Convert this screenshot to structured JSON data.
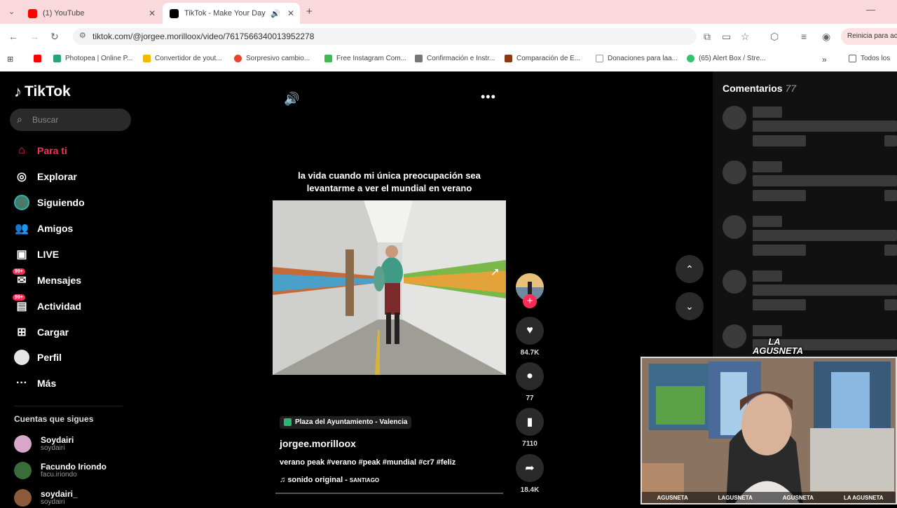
{
  "browser": {
    "tabs": [
      {
        "title": "(1) YouTube",
        "active": false
      },
      {
        "title": "TikTok - Make Your Day",
        "active": true
      }
    ],
    "url": "tiktok.com/@jorgee.morilloox/video/7617566340013952278",
    "restart_label": "Reinicia para act",
    "bookmarks": [
      "Photopea | Online P...",
      "Convertidor de yout...",
      "Sorpresivo cambio...",
      "Free Instagram Com...",
      "Confirmación e Instr...",
      "Comparación de E...",
      "Donaciones para laa...",
      "(65) Alert Box / Stre..."
    ],
    "all_bookmarks": "Todos los"
  },
  "sidebar": {
    "logo": "TikTok",
    "search_placeholder": "Buscar",
    "nav": [
      {
        "label": "Para ti"
      },
      {
        "label": "Explorar"
      },
      {
        "label": "Siguiendo"
      },
      {
        "label": "Amigos"
      },
      {
        "label": "LIVE"
      },
      {
        "label": "Mensajes",
        "badge": "99+"
      },
      {
        "label": "Actividad",
        "badge": "99+"
      },
      {
        "label": "Cargar"
      },
      {
        "label": "Perfil"
      },
      {
        "label": "Más"
      }
    ],
    "following_title": "Cuentas que sigues",
    "accounts": [
      {
        "name": "Soydairi",
        "user": "soydairi"
      },
      {
        "name": "Facundo Iriondo",
        "user": "facu.iriondo"
      },
      {
        "name": "soydairi_",
        "user": "soydairi"
      }
    ]
  },
  "video": {
    "caption": "la vida cuando mi única preocupación sea levantarme a ver el mundial en verano",
    "location": "Plaza del Ayuntamiento - Valencia",
    "author": "jorgee.morilloox",
    "description": "verano peak #verano #peak #mundial #cr7 #feliz",
    "sound": "sonido original - ",
    "sound_artist": "SANTIAGO",
    "likes": "84.7K",
    "comments": "77",
    "saves": "7110",
    "shares": "18.4K"
  },
  "comments_panel": {
    "title": "Comentarios",
    "count": "77"
  },
  "webcam": {
    "brand": "LA AGUSNETA",
    "socials": [
      "AGUSNETA",
      "LAGUSNETA",
      "AGUSNETA",
      "LA AGUSNETA"
    ]
  }
}
